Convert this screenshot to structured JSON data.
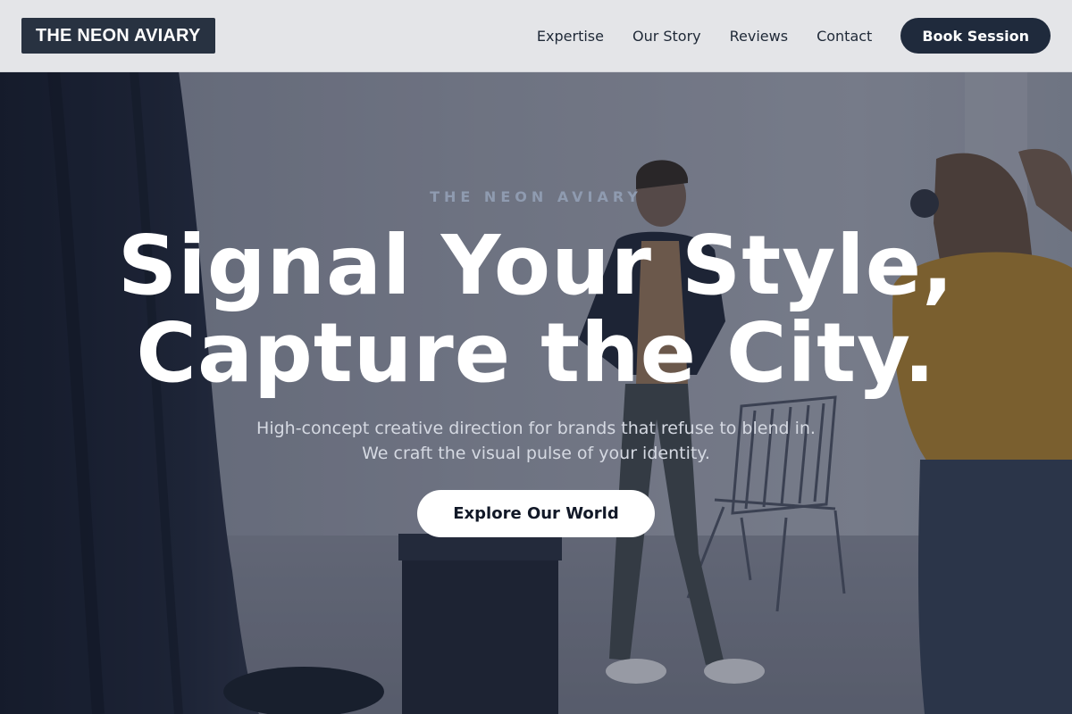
{
  "header": {
    "logo": "THE NEON AVIARY",
    "nav": [
      {
        "label": "Expertise"
      },
      {
        "label": "Our Story"
      },
      {
        "label": "Reviews"
      },
      {
        "label": "Contact"
      }
    ],
    "cta": "Book Session"
  },
  "hero": {
    "eyebrow": "THE NEON AVIARY",
    "headline_line1": "Signal Your Style,",
    "headline_line2": "Capture the City.",
    "subtext_line1": "High-concept creative direction for brands that refuse to blend in.",
    "subtext_line2": "We craft the visual pulse of your identity.",
    "cta": "Explore Our World"
  },
  "colors": {
    "header_bg": "#e4e5e8",
    "brand_dark": "#1f2a3c",
    "eyebrow": "#8f9bb0",
    "hero_text": "#ffffff",
    "subtext": "#d5d9e2"
  },
  "icons": {
    "hero_image": "photo-shoot-studio-image"
  }
}
